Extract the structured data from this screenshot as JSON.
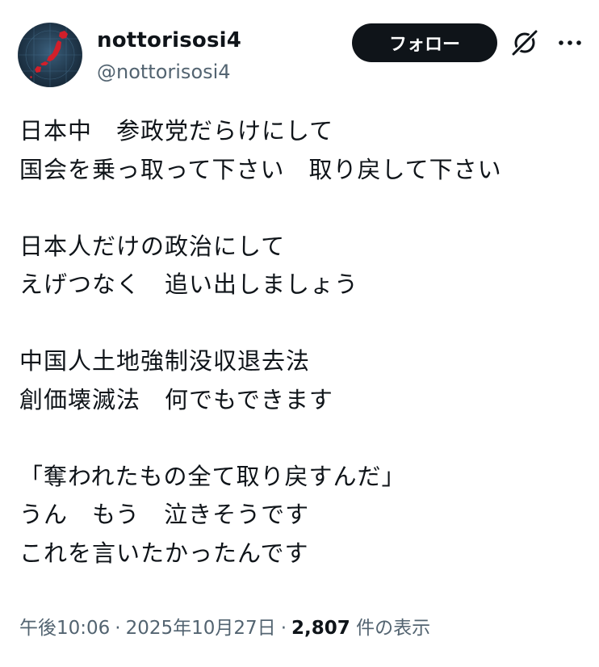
{
  "author": {
    "display_name": "nottorisosi4",
    "handle": "@nottorisosi4"
  },
  "follow_button_label": "フォロー",
  "icons": {
    "avatar": "japan-map-avatar",
    "grok": "grok-icon",
    "more": "more-icon"
  },
  "tweet": {
    "lines": [
      "日本中　参政党だらけにして",
      "国会を乗っ取って下さい　取り戻して下さい",
      "",
      "日本人だけの政治にして",
      "えげつなく　追い出しましょう",
      "",
      "中国人土地強制没収退去法",
      "創価壊滅法　何でもできます",
      "",
      "「奪われたもの全て取り戻すんだ」",
      "うん　もう　泣きそうです",
      "これを言いたかったんです"
    ]
  },
  "meta": {
    "time": "午後10:06",
    "date": "2025年10月27日",
    "separator": "·",
    "views_count": "2,807",
    "views_label": "件の表示"
  },
  "colors": {
    "text": "#0f1419",
    "secondary": "#536471",
    "button_bg": "#0f1419",
    "avatar_map": "#d11f2a"
  }
}
